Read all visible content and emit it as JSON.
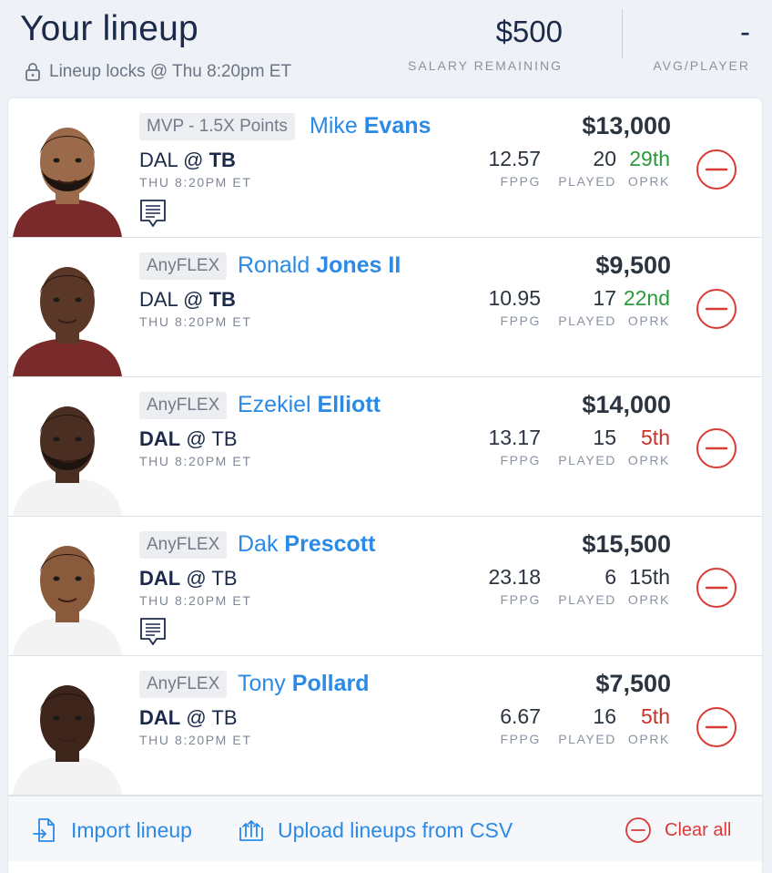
{
  "header": {
    "title": "Your lineup",
    "locks_text": "Lineup locks @ Thu 8:20pm ET",
    "salary_remaining_value": "$500",
    "salary_remaining_label": "SALARY REMAINING",
    "avg_player_value": "-",
    "avg_player_label": "AVG/PLAYER"
  },
  "labels": {
    "fppg": "FPPG",
    "played": "PLAYED",
    "oprk": "OPRK"
  },
  "players": [
    {
      "position": "MVP - 1.5X Points",
      "first": "Mike",
      "last": "Evans",
      "away": "DAL",
      "at": "@",
      "home": "TB",
      "bold_team": "home",
      "time": "THU 8:20PM ET",
      "salary": "$13,000",
      "fppg": "12.57",
      "played": "20",
      "oprk": "29th",
      "oprk_color": "#2a9a3a",
      "has_note": true,
      "skin": "#9a6a4a"
    },
    {
      "position": "AnyFLEX",
      "first": "Ronald",
      "last": "Jones II",
      "away": "DAL",
      "at": "@",
      "home": "TB",
      "bold_team": "home",
      "time": "THU 8:20PM ET",
      "salary": "$9,500",
      "fppg": "10.95",
      "played": "17",
      "oprk": "22nd",
      "oprk_color": "#2a9a3a",
      "has_note": false,
      "skin": "#5a3726"
    },
    {
      "position": "AnyFLEX",
      "first": "Ezekiel",
      "last": "Elliott",
      "away": "DAL",
      "at": "@",
      "home": "TB",
      "bold_team": "away",
      "time": "THU 8:20PM ET",
      "salary": "$14,000",
      "fppg": "13.17",
      "played": "15",
      "oprk": "5th",
      "oprk_color": "#c8322b",
      "has_note": false,
      "skin": "#4a2e22"
    },
    {
      "position": "AnyFLEX",
      "first": "Dak",
      "last": "Prescott",
      "away": "DAL",
      "at": "@",
      "home": "TB",
      "bold_team": "away",
      "time": "THU 8:20PM ET",
      "salary": "$15,500",
      "fppg": "23.18",
      "played": "6",
      "oprk": "15th",
      "oprk_color": "#2c3440",
      "has_note": true,
      "skin": "#8a5a3c"
    },
    {
      "position": "AnyFLEX",
      "first": "Tony",
      "last": "Pollard",
      "away": "DAL",
      "at": "@",
      "home": "TB",
      "bold_team": "away",
      "time": "THU 8:20PM ET",
      "salary": "$7,500",
      "fppg": "6.67",
      "played": "16",
      "oprk": "5th",
      "oprk_color": "#c8322b",
      "has_note": false,
      "skin": "#3d251b"
    }
  ],
  "footer": {
    "import_label": "Import lineup",
    "upload_label": "Upload lineups from CSV",
    "clear_label": "Clear all"
  },
  "icons": {
    "lock": "lock-icon",
    "note": "notes-icon",
    "remove": "remove-circle-icon",
    "import": "import-icon",
    "upload": "upload-icon",
    "clear": "clear-circle-icon"
  },
  "colors": {
    "accent": "#2a8ae6",
    "danger": "#d93a35",
    "good": "#2a9a3a",
    "background": "#eef1f6"
  }
}
